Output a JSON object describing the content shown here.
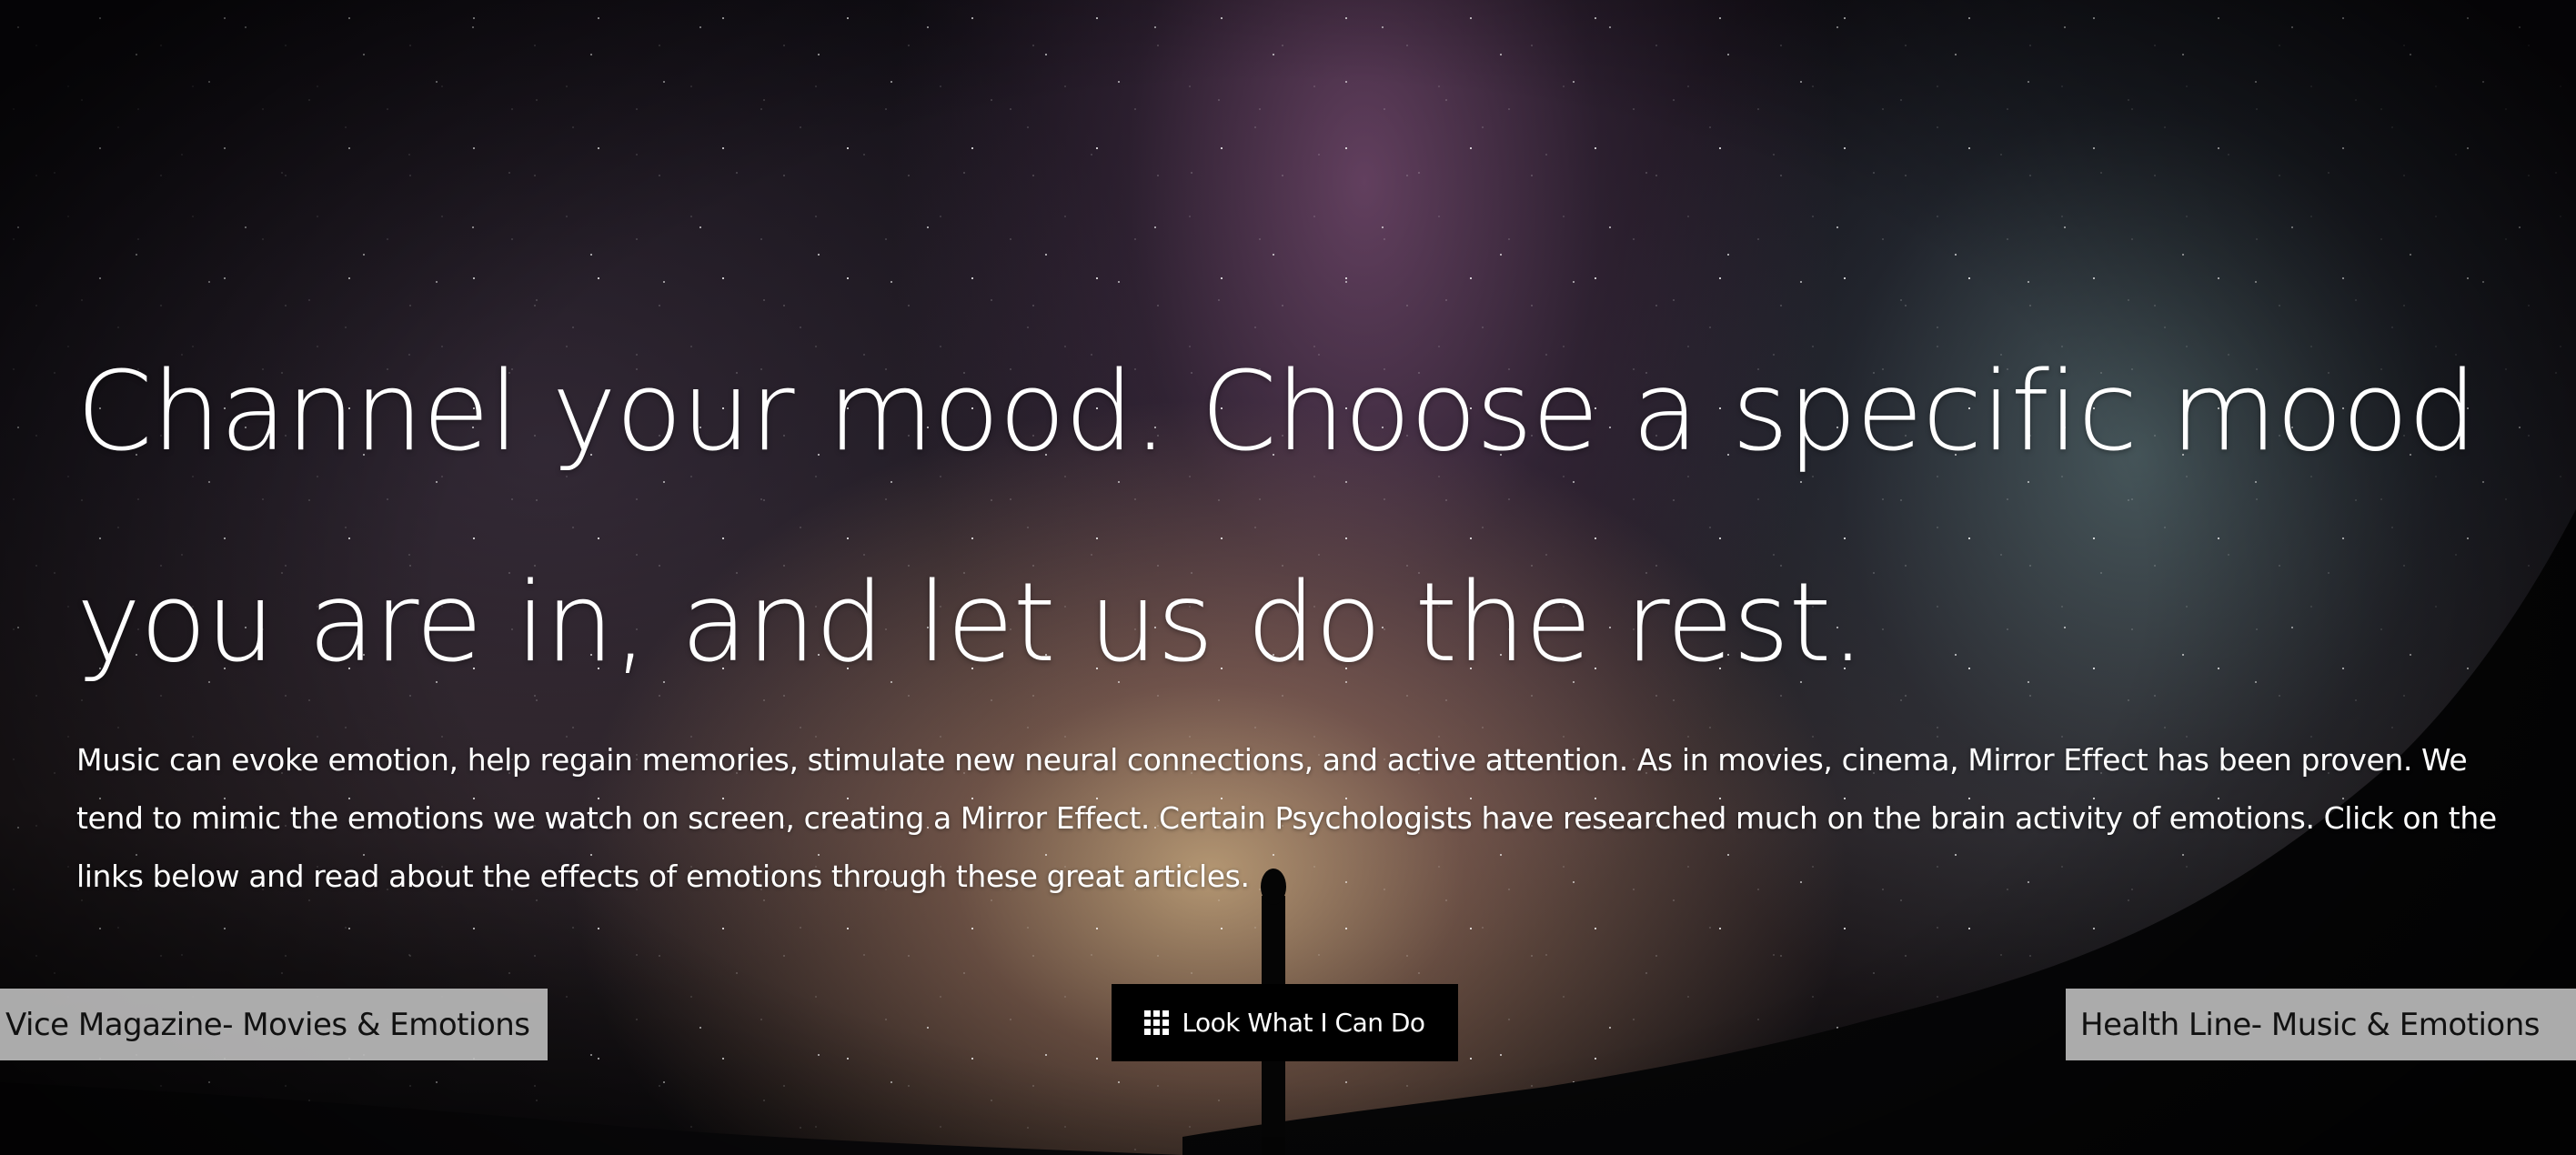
{
  "hero": {
    "headline": "Channel your mood. Choose a specific mood you are in, and let us do the rest.",
    "intro": "Music can evoke emotion, help regain memories, stimulate new neural connections, and active attention. As in movies, cinema, Mirror Effect has been proven. We tend to mimic the emotions we watch on screen, creating a Mirror Effect. Certain Psychologists have researched much on the brain activity of emotions. Click on the links below and read about the effects of emotions through these great articles."
  },
  "links": {
    "left_label": "Vice Magazine- Movies & Emotions",
    "right_label": "Health Line- Music & Emotions"
  },
  "cta": {
    "label": "Look What I Can Do",
    "icon": "grid-icon"
  },
  "colors": {
    "link_background": "#bebebe",
    "cta_background": "#000000",
    "text": "#ffffff"
  }
}
